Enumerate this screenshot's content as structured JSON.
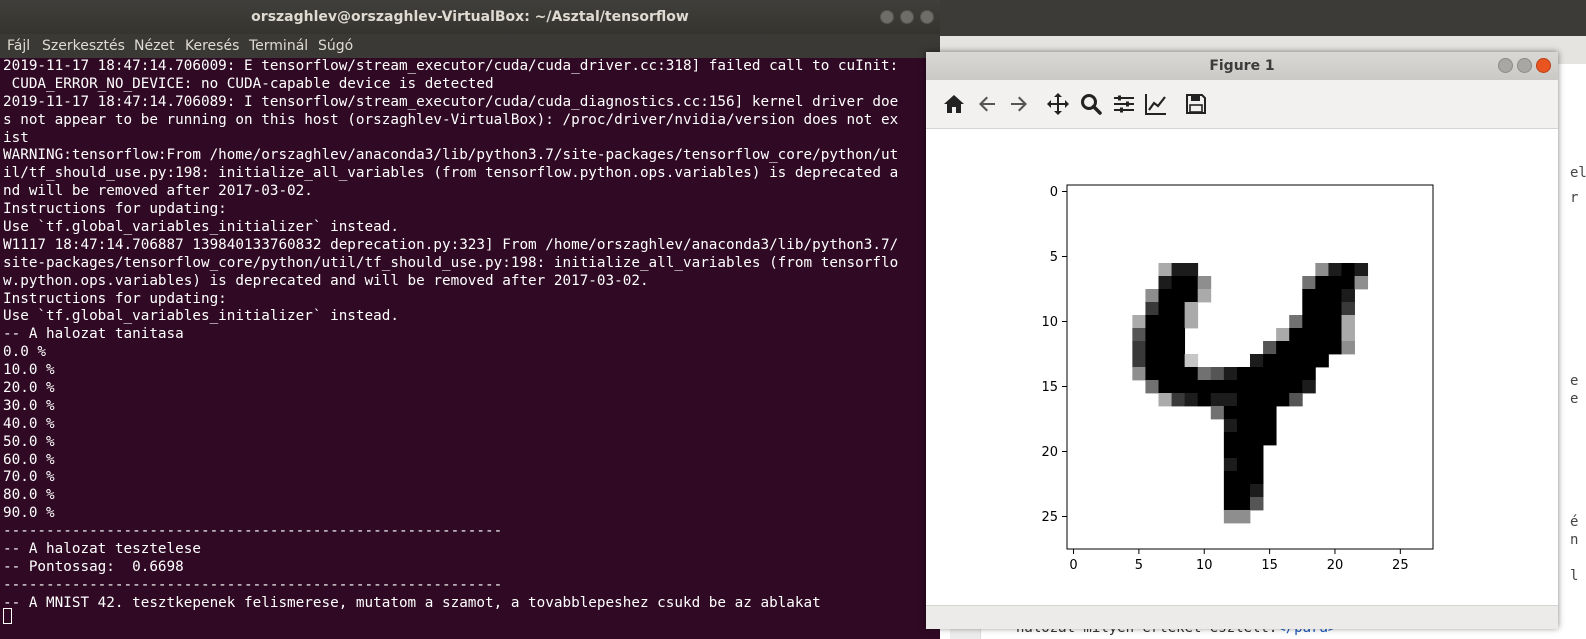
{
  "terminal": {
    "title": "orszaghlev@orszaghlev-VirtualBox: ~/Asztal/tensorflow",
    "menu": [
      "Fájl",
      "Szerkesztés",
      "Nézet",
      "Keresés",
      "Terminál",
      "Súgó"
    ],
    "lines": [
      "2019-11-17 18:47:14.706009: E tensorflow/stream_executor/cuda/cuda_driver.cc:318] failed call to cuInit:",
      " CUDA_ERROR_NO_DEVICE: no CUDA-capable device is detected",
      "2019-11-17 18:47:14.706089: I tensorflow/stream_executor/cuda/cuda_diagnostics.cc:156] kernel driver doe",
      "s not appear to be running on this host (orszaghlev-VirtualBox): /proc/driver/nvidia/version does not ex",
      "ist",
      "WARNING:tensorflow:From /home/orszaghlev/anaconda3/lib/python3.7/site-packages/tensorflow_core/python/ut",
      "il/tf_should_use.py:198: initialize_all_variables (from tensorflow.python.ops.variables) is deprecated a",
      "nd will be removed after 2017-03-02.",
      "Instructions for updating:",
      "Use `tf.global_variables_initializer` instead.",
      "W1117 18:47:14.706887 139840133760832 deprecation.py:323] From /home/orszaghlev/anaconda3/lib/python3.7/",
      "site-packages/tensorflow_core/python/util/tf_should_use.py:198: initialize_all_variables (from tensorflo",
      "w.python.ops.variables) is deprecated and will be removed after 2017-03-02.",
      "Instructions for updating:",
      "Use `tf.global_variables_initializer` instead.",
      "-- A halozat tanitasa",
      "0.0 %",
      "10.0 %",
      "20.0 %",
      "30.0 %",
      "40.0 %",
      "50.0 %",
      "60.0 %",
      "70.0 %",
      "80.0 %",
      "90.0 %",
      "----------------------------------------------------------",
      "-- A halozat tesztelese",
      "-- Pontossag:  0.6698",
      "----------------------------------------------------------",
      "-- A MNIST 42. tesztkepenek felismerese, mutatom a szamot, a tovabblepeshez csukd be az ablakat"
    ]
  },
  "background_window": {
    "bottom_text": "halozat milyen erteket eszlelt.",
    "bottom_tag": "</para>",
    "right_edge_chars": [
      "r",
      "ela",
      "e",
      "e",
      "é",
      "n",
      "l"
    ]
  },
  "figure": {
    "title": "Figure 1",
    "toolbar_icons": [
      "home-icon",
      "back-arrow-icon",
      "forward-arrow-icon",
      "pan-icon",
      "zoom-icon",
      "subplots-icon",
      "axes-edit-icon",
      "save-icon"
    ],
    "colors": {
      "ink": "#000000",
      "paper": "#ffffff"
    }
  },
  "chart_data": {
    "type": "heatmap",
    "description_colormap": "gray_r",
    "xlim": [
      -0.5,
      27.5
    ],
    "ylim": [
      27.5,
      -0.5
    ],
    "xticks": [
      0,
      5,
      10,
      15,
      20,
      25
    ],
    "yticks": [
      0,
      5,
      10,
      15,
      20,
      25
    ],
    "grid": false,
    "rows": [
      "............................",
      "............................",
      "............................",
      "............................",
      "............................",
      "............................",
      "........................9...",
      "........................99..",
      ".......89...........999999..",
      ".......99...........99.99...",
      ".......99..........99..99...",
      ".......99..........999......",
      ".......99..........99.......",
      ".......99.........99........",
      "........99.....9999.........",
      ".........99999999...........",
      "................99..........",
      "...............99...........",
      "...............99...........",
      "...............99...........",
      "...............99...........",
      "...............99...........",
      "...............99...........",
      "...............99...........",
      "...............99...........",
      "...............99...........",
      "............................",
      "............................"
    ],
    "pixels": [
      "............................",
      "............................",
      "............................",
      "............................",
      "............................",
      "............................",
      ".......388.........4898.....",
      ".......8994.......59994.....",
      "......49993.......9998......",
      "......7993........9997......",
      ".....39993.......59993......",
      ".....6999.......399993......",
      ".....7999......6999994......",
      ".....79992....899999........",
      ".....49999568999999.........",
      "......5999999999998.........",
      ".......37898899996..........",
      "...........59999............",
      "............8999............",
      "............9999............",
      "............999.............",
      "............899.............",
      "............999.............",
      "............998.............",
      "............996.............",
      "............44..............",
      "............................",
      "............................"
    ]
  }
}
